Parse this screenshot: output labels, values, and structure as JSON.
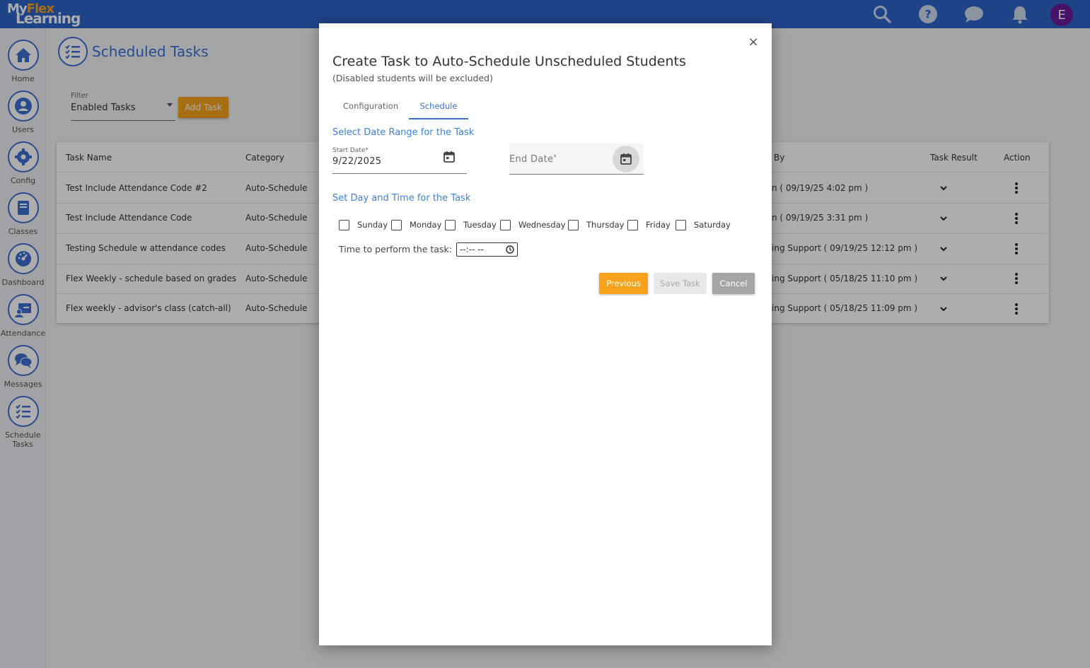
{
  "app": {
    "logo_line1_a": "My",
    "logo_line1_b": "Flex",
    "logo_line2": "Learning",
    "avatar_initial": "E",
    "colors": {
      "topbar": "#2d63c8",
      "accent": "#3d6fd0",
      "orange": "#f7a21b",
      "avatar": "#6a1b9a"
    },
    "top_icons": [
      "search-icon",
      "help-icon",
      "chat-icon",
      "bell-icon"
    ]
  },
  "sidebar": {
    "items": [
      {
        "label": "Home",
        "icon": "home-icon"
      },
      {
        "label": "Users",
        "icon": "user-icon"
      },
      {
        "label": "Config",
        "icon": "gear-icon"
      },
      {
        "label": "Classes",
        "icon": "book-icon"
      },
      {
        "label": "Dashboard",
        "icon": "dashboard-icon"
      },
      {
        "label": "Attendance",
        "icon": "attendance-icon"
      },
      {
        "label": "Messages",
        "icon": "messages-icon"
      },
      {
        "label": "Schedule Tasks",
        "icon": "checklist-icon"
      }
    ]
  },
  "page": {
    "title": "Scheduled Tasks",
    "filter_label": "Filter",
    "filter_value": "Enabled Tasks",
    "add_task_label": "Add Task",
    "table": {
      "headers": {
        "task_name": "Task Name",
        "category": "Category",
        "by": "By",
        "task_result": "Task Result",
        "action": "Action"
      },
      "rows": [
        {
          "task_name": "Test Include Attendance Code #2",
          "category": "Auto-Schedule",
          "by": "n ( 09/19/25 4:02 pm )"
        },
        {
          "task_name": "Test Include Attendance Code",
          "category": "Auto-Schedule",
          "by": "n ( 09/19/25 3:31 pm )"
        },
        {
          "task_name": "Testing Schedule w attendance codes",
          "category": "Auto-Schedule",
          "by": "ing Support ( 09/19/25 12:12 pm )"
        },
        {
          "task_name": "Flex Weekly - schedule based on grades",
          "category": "Auto-Schedule",
          "by": "ing Support ( 05/18/25 11:10 pm )"
        },
        {
          "task_name": "Flex weekly - advisor's class (catch-all)",
          "category": "Auto-Schedule",
          "by": "ing Support ( 05/18/25 11:09 pm )"
        }
      ]
    }
  },
  "modal": {
    "close_label": "×",
    "title": "Create Task to Auto-Schedule Unscheduled Students",
    "subtitle": "(Disabled students will be excluded)",
    "tabs": {
      "configuration": "Configuration",
      "schedule": "Schedule"
    },
    "date_range_title": "Select Date Range for the Task",
    "start_date_label": "Start Date",
    "start_date_value": "9/22/2025",
    "end_date_label": "End Date",
    "required_mark": "*",
    "day_time_title": "Set Day and Time for the Task",
    "days": [
      "Sunday",
      "Monday",
      "Tuesday",
      "Wednesday",
      "Thursday",
      "Friday",
      "Saturday"
    ],
    "time_label": "Time to perform the task:",
    "time_placeholder": "--:-- --",
    "buttons": {
      "previous": "Previous",
      "save": "Save Task",
      "cancel": "Cancel"
    }
  }
}
